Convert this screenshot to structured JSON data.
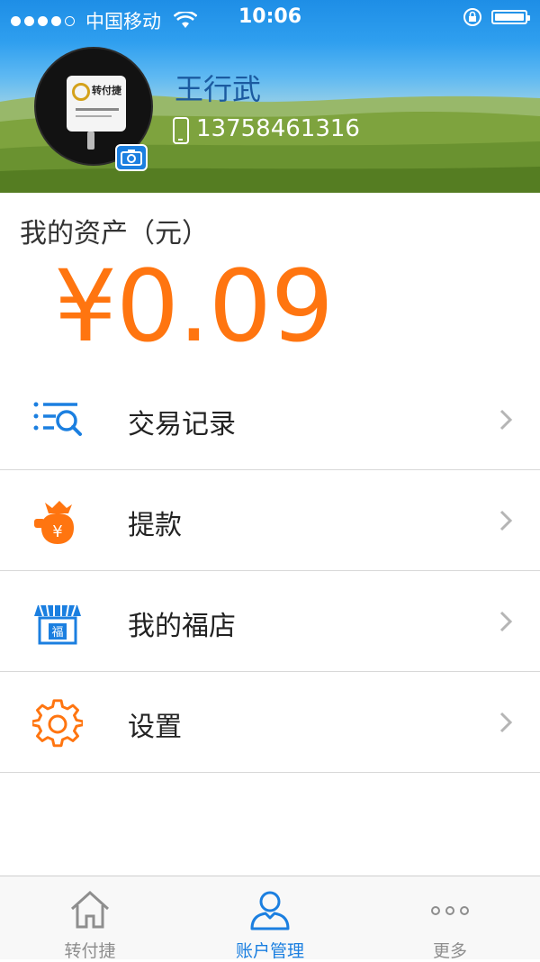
{
  "status_bar": {
    "carrier": "中国移动",
    "time": "10:06",
    "icons": [
      "signal-dots",
      "wifi-icon",
      "rotation-lock-icon",
      "battery-icon"
    ]
  },
  "profile": {
    "name": "王行武",
    "phone": "13758461316",
    "avatar_brand": "转付捷"
  },
  "assets": {
    "label": "我的资产（元）",
    "amount": "¥0.09",
    "amount_color": "#ff7510"
  },
  "menu": {
    "items": [
      {
        "label": "交易记录",
        "icon": "transaction-search-icon"
      },
      {
        "label": "提款",
        "icon": "money-bag-icon"
      },
      {
        "label": "我的福店",
        "icon": "store-icon"
      },
      {
        "label": "设置",
        "icon": "gear-icon"
      }
    ]
  },
  "tabbar": {
    "items": [
      {
        "label": "转付捷",
        "icon": "home-icon"
      },
      {
        "label": "账户管理",
        "icon": "user-icon"
      },
      {
        "label": "更多",
        "icon": "more-icon"
      }
    ],
    "active_index": 1,
    "active_color": "#1b7fe0",
    "inactive_color": "#8e8e8e"
  },
  "colors": {
    "accent_blue": "#1b7fe0",
    "accent_orange": "#ff7510"
  }
}
